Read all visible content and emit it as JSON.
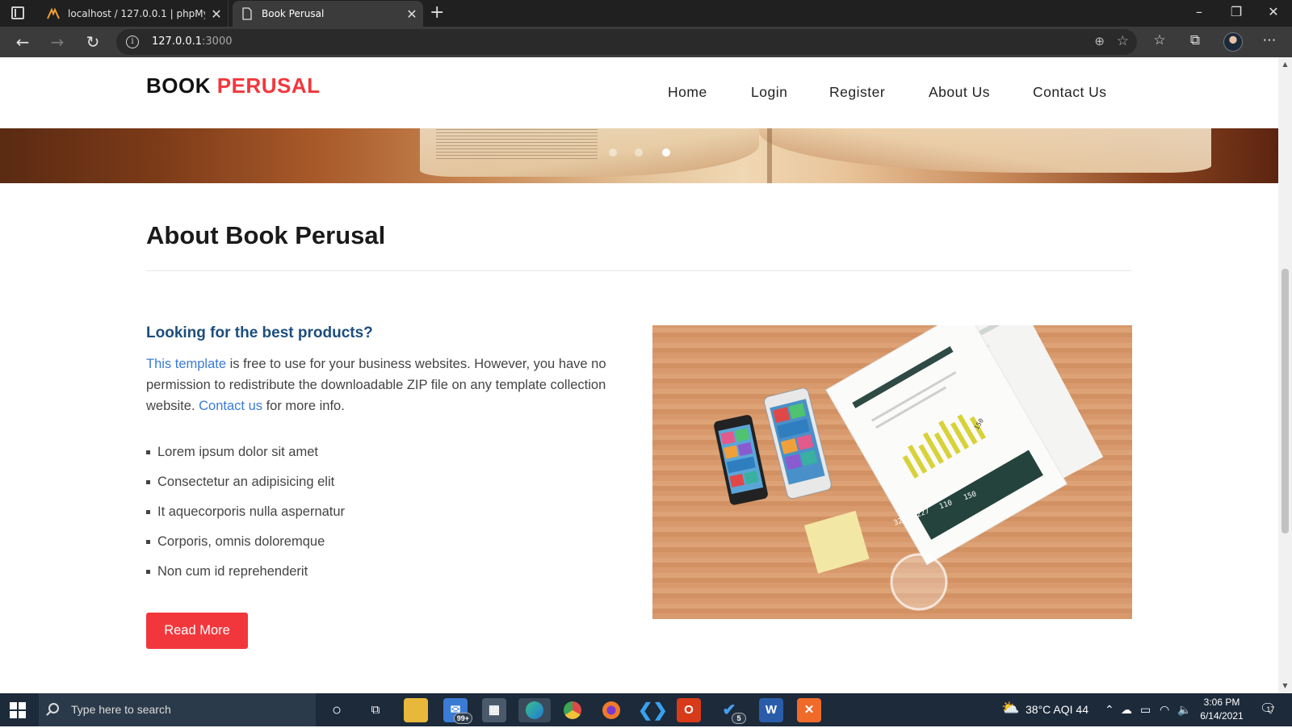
{
  "browser": {
    "tabs": [
      {
        "title": "localhost / 127.0.0.1 | phpMyAdmin",
        "icon": "phpmyadmin-icon"
      },
      {
        "title": "Book Perusal",
        "icon": "page-icon"
      }
    ],
    "address": {
      "host": "127.0.0.1",
      "port": ":3000"
    }
  },
  "site": {
    "brand_main": "BOOK",
    "brand_accent": "PERUSAL",
    "nav": [
      "Home",
      "Login",
      "Register",
      "About Us",
      "Contact Us"
    ],
    "carousel_active_index": 2
  },
  "about": {
    "title": "About Book Perusal",
    "subheading": "Looking for the best products?",
    "para_link1": "This template",
    "para_text1": " is free to use for your business websites. However, you have no permission to redistribute the downloadable ZIP file on any template collection website. ",
    "para_link2": "Contact us",
    "para_text2": " for more info.",
    "list": [
      "Lorem ipsum dolor sit amet",
      "Consectetur an adipisicing elit",
      "It aquecorporis nulla aspernatur",
      "Corporis, omnis doloremque",
      "Non cum id reprehenderit"
    ],
    "button": "Read More",
    "photo_numbers": [
      "32",
      "227",
      "110",
      "150"
    ],
    "photo_paper_number": "150"
  },
  "taskbar": {
    "search_placeholder": "Type here to search",
    "mail_badge": "99+",
    "todo_badge": "5",
    "weather": "38°C  AQI 44",
    "time": "3:06 PM",
    "date": "6/14/2021",
    "notifications": "17"
  },
  "colors": {
    "accent": "#f2373c",
    "link": "#3a7bd5",
    "subheading": "#1d4e7e"
  }
}
